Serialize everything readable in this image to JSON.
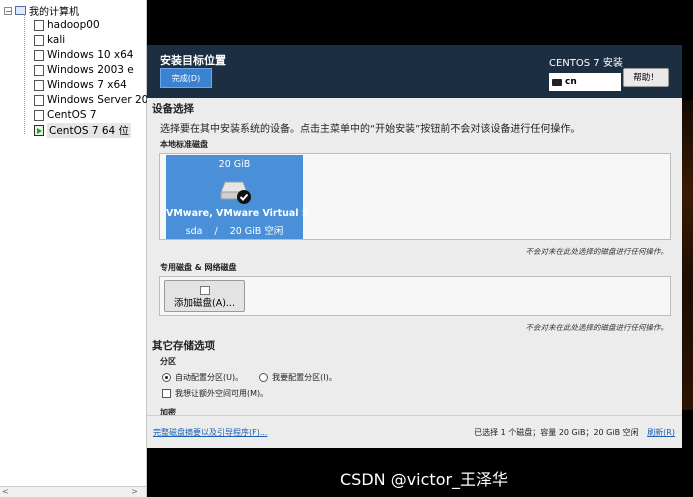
{
  "library": {
    "root_label": "我的计算机",
    "items": [
      {
        "label": "hadoop00",
        "state": "stopped"
      },
      {
        "label": "kali",
        "state": "stopped"
      },
      {
        "label": "Windows 10 x64",
        "state": "stopped"
      },
      {
        "label": "Windows 2003 e",
        "state": "stopped"
      },
      {
        "label": "Windows 7 x64",
        "state": "stopped"
      },
      {
        "label": "Windows Server 20",
        "state": "stopped"
      },
      {
        "label": "CentOS 7",
        "state": "stopped"
      },
      {
        "label": "CentOS 7 64 位",
        "state": "running",
        "selected": true
      }
    ]
  },
  "installer": {
    "page_title": "安装目标位置",
    "done_button": "完成(D)",
    "product_title": "CENTOS 7 安装",
    "keyboard_layout": "cn",
    "help_button": "帮助！",
    "device_selection": {
      "heading": "设备选择",
      "description": "选择要在其中安装系统的设备。点击主菜单中的“开始安装”按钮前不会对该设备进行任何操作。",
      "local_disks_label": "本地标准磁盘",
      "disk": {
        "size": "20 GiB",
        "name": "VMware, VMware Virtual S",
        "device": "sda",
        "separator": "/",
        "free": "20 GiB 空闲"
      },
      "local_hint": "不会对未在此处选择的磁盘进行任何操作。",
      "special_disks_label": "专用磁盘 & 网络磁盘",
      "add_disk_button": "添加磁盘(A)...",
      "special_hint": "不会对未在此处选择的磁盘进行任何操作。"
    },
    "other_storage": {
      "heading": "其它存储选项",
      "partition_label": "分区",
      "auto_partition": "自动配置分区(U)。",
      "manual_partition": "我要配置分区(I)。",
      "extra_space": "我想让额外空间可用(M)。",
      "encryption_label": "加密"
    },
    "footer": {
      "summary_link": "完整磁盘摘要以及引导程序(F)...",
      "status": "已选择 1 个磁盘；容量 20 GiB；20 GiB 空闲",
      "refresh": "刷新(R)"
    }
  },
  "watermark": "CSDN @victor_王泽华",
  "colors": {
    "header_bg": "#1c2e41",
    "accent_blue": "#4a90d9",
    "done_button": "#3b83d0",
    "link": "#1a5fb4"
  }
}
